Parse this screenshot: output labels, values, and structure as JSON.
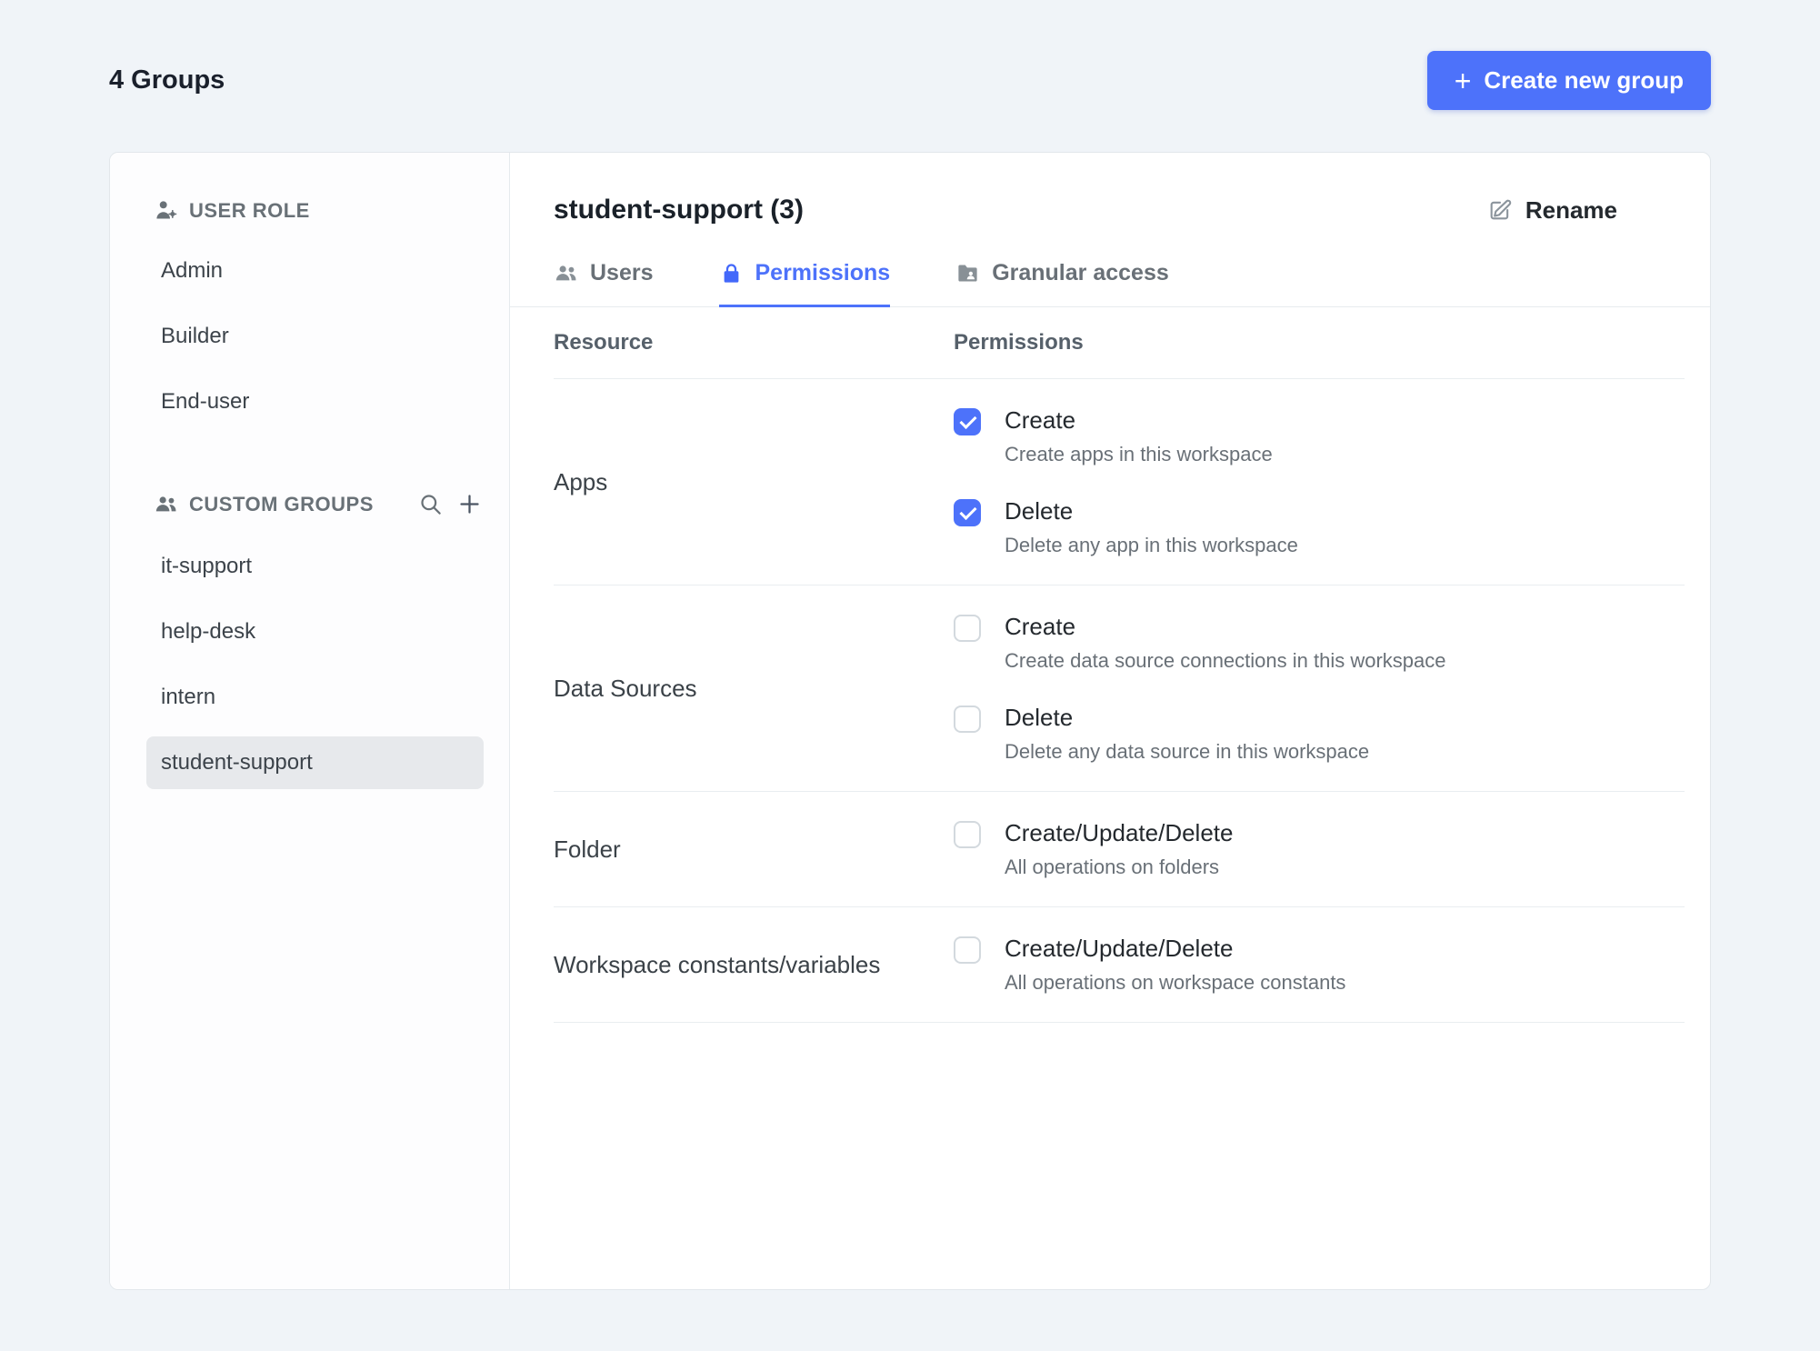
{
  "colors": {
    "accent": "#4D72FA",
    "background": "#F0F4F8"
  },
  "header": {
    "title": "4 Groups",
    "create_button": "Create new group"
  },
  "sidebar": {
    "user_role": {
      "header": "USER ROLE",
      "items": [
        "Admin",
        "Builder",
        "End-user"
      ]
    },
    "custom_groups": {
      "header": "CUSTOM GROUPS",
      "items": [
        {
          "label": "it-support",
          "selected": false
        },
        {
          "label": "help-desk",
          "selected": false
        },
        {
          "label": "intern",
          "selected": false
        },
        {
          "label": "student-support",
          "selected": true
        }
      ]
    }
  },
  "main": {
    "title": "student-support (3)",
    "rename_button": "Rename",
    "tabs": [
      {
        "label": "Users",
        "active": false
      },
      {
        "label": "Permissions",
        "active": true
      },
      {
        "label": "Granular access",
        "active": false
      }
    ],
    "table": {
      "columns": {
        "resource": "Resource",
        "permissions": "Permissions"
      },
      "rows": [
        {
          "resource": "Apps",
          "permissions": [
            {
              "label": "Create",
              "description": "Create apps in this workspace",
              "checked": true
            },
            {
              "label": "Delete",
              "description": "Delete any app in this workspace",
              "checked": true
            }
          ]
        },
        {
          "resource": "Data Sources",
          "permissions": [
            {
              "label": "Create",
              "description": "Create data source connections in this workspace",
              "checked": false
            },
            {
              "label": "Delete",
              "description": "Delete any data source in this workspace",
              "checked": false
            }
          ]
        },
        {
          "resource": "Folder",
          "permissions": [
            {
              "label": "Create/Update/Delete",
              "description": "All operations on folders",
              "checked": false
            }
          ]
        },
        {
          "resource": "Workspace constants/variables",
          "permissions": [
            {
              "label": "Create/Update/Delete",
              "description": "All operations on workspace constants",
              "checked": false
            }
          ]
        }
      ]
    }
  }
}
